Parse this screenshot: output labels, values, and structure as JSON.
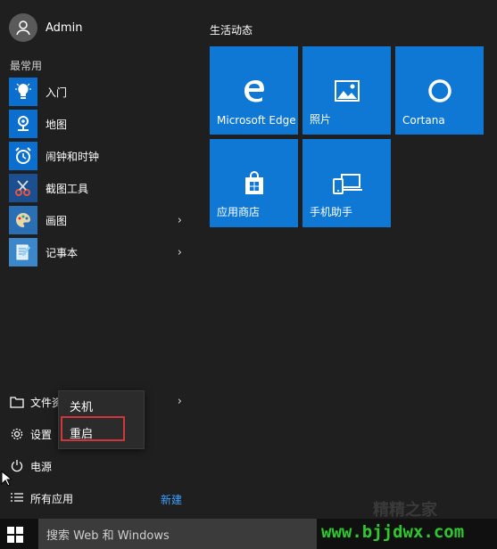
{
  "user": {
    "name": "Admin"
  },
  "left": {
    "frequent_label": "最常用",
    "apps": [
      {
        "label": "入门",
        "icon": "lightbulb-icon",
        "has_submenu": false
      },
      {
        "label": "地图",
        "icon": "map-icon",
        "has_submenu": false
      },
      {
        "label": "闹钟和时钟",
        "icon": "alarm-clock-icon",
        "has_submenu": false
      },
      {
        "label": "截图工具",
        "icon": "snipping-tool-icon",
        "has_submenu": false
      },
      {
        "label": "画图",
        "icon": "paint-palette-icon",
        "has_submenu": true
      },
      {
        "label": "记事本",
        "icon": "notepad-icon",
        "has_submenu": true
      }
    ],
    "system": {
      "file_explorer": "文件资源管理器",
      "settings": "设置",
      "power": "电源",
      "all_apps": "所有应用",
      "new_badge": "新建"
    }
  },
  "power_menu": {
    "items": [
      "关机",
      "重启"
    ],
    "highlighted": "重启"
  },
  "right": {
    "group_title": "生活动态",
    "tiles": [
      {
        "label": "Microsoft Edge",
        "icon": "edge-icon"
      },
      {
        "label": "照片",
        "icon": "photos-icon"
      },
      {
        "label": "Cortana",
        "icon": "cortana-icon"
      },
      {
        "label": "应用商店",
        "icon": "store-icon"
      },
      {
        "label": "手机助手",
        "icon": "phone-companion-icon"
      }
    ]
  },
  "taskbar": {
    "search_placeholder": "搜索 Web 和 Windows",
    "watermark": "www.bjjdwx.com",
    "watermark_cn": "精精之家"
  },
  "colors": {
    "background": "#1f1f1f",
    "tile": "#0f78d4",
    "accent_link": "#3aa0ff",
    "highlight_box": "#d0363c",
    "watermark": "#2ec82e"
  }
}
